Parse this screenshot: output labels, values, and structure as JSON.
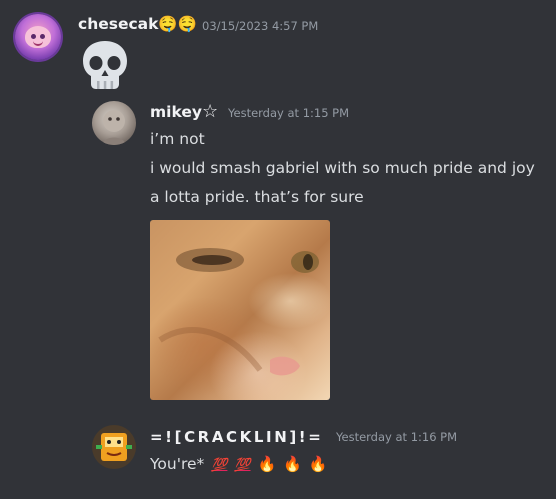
{
  "messages": [
    {
      "username": "chesecak🤤🤤",
      "timestamp": "03/15/2023 4:57 PM",
      "content_icon": "skull-icon"
    },
    {
      "username": "mikey",
      "badge": "☆",
      "timestamp": "Yesterday at 1:15 PM",
      "lines": [
        "i’m not",
        "i would smash gabriel with so much pride and joy",
        "a lotta pride. that’s for sure"
      ],
      "attachment": "cat-image"
    },
    {
      "username": "=![CRACKLIN]!=",
      "timestamp": "Yesterday at 1:16 PM",
      "text": "You're*",
      "emojis": [
        "💯",
        "💯",
        "🔥",
        "🔥",
        "🔥"
      ]
    }
  ]
}
